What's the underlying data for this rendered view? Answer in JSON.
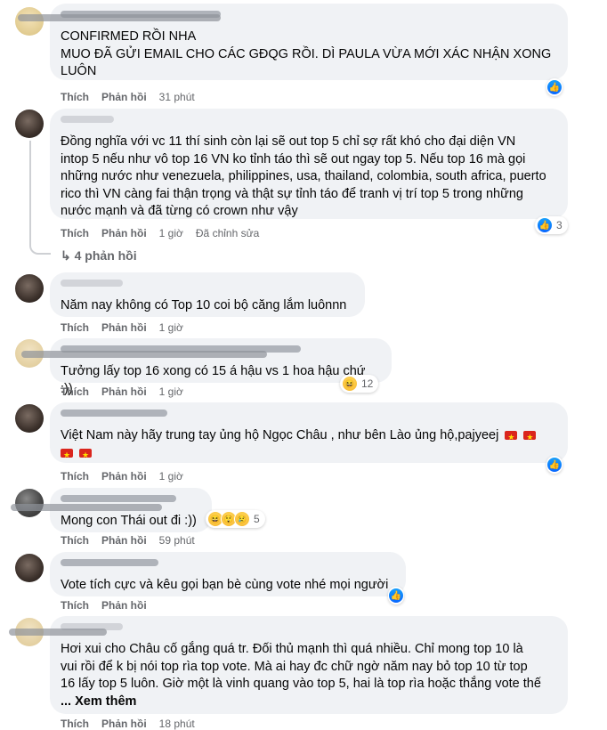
{
  "actions": {
    "like": "Thích",
    "reply": "Phản hồi",
    "edited": "Đã chỉnh sửa"
  },
  "comments": [
    {
      "lines": [
        "CONFIRMED RỒI NHA",
        "MUO ĐÃ GỬI EMAIL CHO CÁC GĐQG RỒI. DÌ PAULA VỪA MỚI XÁC NHẬN XONG",
        "LUÔN"
      ],
      "time": "31 phút",
      "reaction": {
        "type": "like-icon",
        "count": ""
      }
    },
    {
      "lines": [
        "Đồng nghĩa với vc 11 thí sinh còn lại sẽ out top 5 chỉ sợ rất khó cho đại diện VN",
        "intop 5 nếu như vô top 16 VN ko tỉnh táo thì sẽ out ngay top 5. Nếu top 16 mà gọi",
        "những nước như venezuela, philippines, usa, thailand, colombia, south africa, puerto",
        "rico thì VN càng fai thận trọng và thật sự tỉnh táo để tranh vị trí top 5 trong những",
        "nước mạnh và đã từng có crown như vậy"
      ],
      "time": "1 giờ",
      "reaction": {
        "type": "like-icon",
        "count": "3"
      },
      "replies": "4 phản hồi"
    },
    {
      "lines": [
        "Năm nay không có Top 10 coi bộ căng lắm luônnn"
      ],
      "time": "1 giờ"
    },
    {
      "lines": [
        "Tưởng lấy top 16 xong có 15 á hậu vs 1 hoa hậu chứ :))"
      ],
      "time": "1 giờ",
      "reaction": {
        "type": "haha-icon",
        "count": "12"
      }
    },
    {
      "lines": [
        "Việt Nam này hãy trung tay ủng hộ Ngọc Châu , như bên Lào ủng hộ,pajyeej"
      ],
      "time": "1 giờ",
      "reaction": {
        "type": "like-icon",
        "count": ""
      }
    },
    {
      "lines": [
        "Mong con Thái out đi :))"
      ],
      "time": "59 phút",
      "reaction": {
        "type": "haha-icon",
        "count": "5"
      }
    },
    {
      "lines": [
        "Vote tích cực và kêu gọi bạn bè cùng vote nhé mọi người"
      ],
      "time": "",
      "reaction": {
        "type": "like-icon",
        "count": ""
      }
    },
    {
      "lines": [
        "Hơi xui cho Châu cố gắng quá tr. Đối thủ mạnh thì quá nhiều. Chỉ mong top 10 là",
        "vui rồi để k bị nói top rìa top vote. Mà ai hay đc chữ ngờ năm nay bỏ top 10 từ top",
        "16 lấy top 5 luôn. Giờ một là vinh quang vào top 5, hai là top rìa hoặc thắng vote thế"
      ],
      "see_more": "... Xem thêm",
      "time": "18 phút"
    }
  ]
}
